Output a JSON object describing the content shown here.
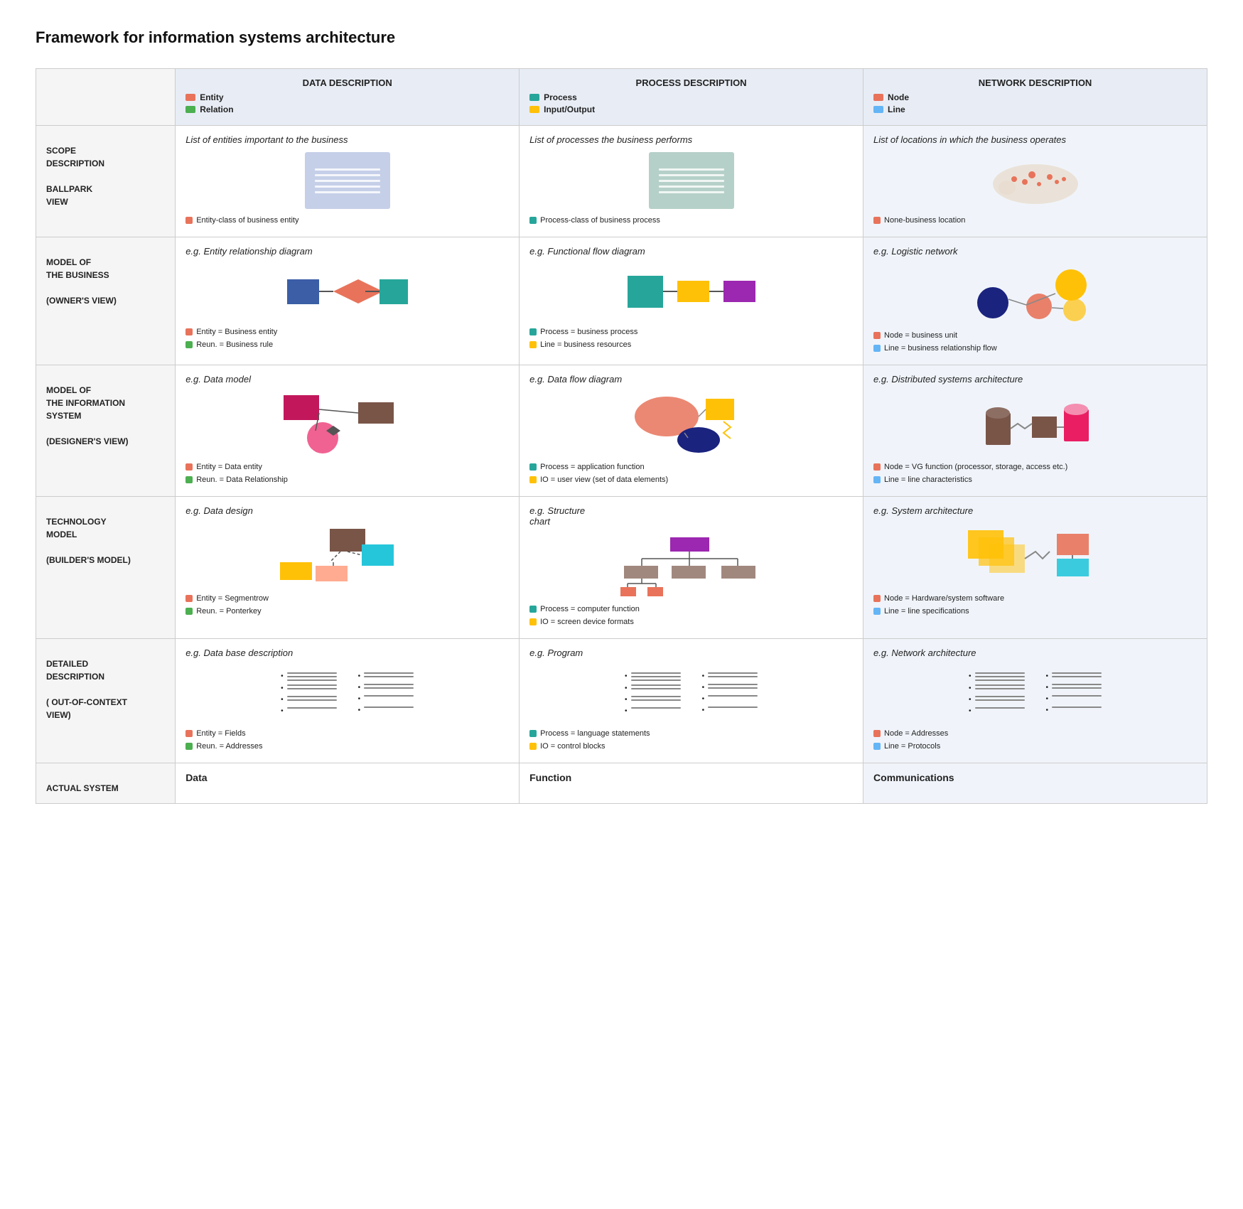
{
  "title": "Framework for information systems architecture",
  "header": {
    "col1": {
      "title": "DATA DESCRIPTION",
      "legend": [
        {
          "color": "#E8735A",
          "label": "Entity"
        },
        {
          "color": "#4CAF50",
          "label": "Relation"
        }
      ]
    },
    "col2": {
      "title": "PROCESS DESCRIPTION",
      "legend": [
        {
          "color": "#26A69A",
          "label": "Process"
        },
        {
          "color": "#FFC107",
          "label": "Input/Output"
        }
      ]
    },
    "col3": {
      "title": "NETWORK DESCRIPTION",
      "legend": [
        {
          "color": "#E8735A",
          "label": "Node"
        },
        {
          "color": "#64B5F6",
          "label": "Line"
        }
      ]
    }
  },
  "rows": [
    {
      "label": "SCOPE DESCRIPTION\n\nBALLPARK VIEW",
      "col1": {
        "title": "List of entities important to the business",
        "caption": [
          {
            "color": "#E8735A",
            "text": "Entity-class of business entity"
          }
        ]
      },
      "col2": {
        "title": "List of processes the business performs",
        "caption": [
          {
            "color": "#26A69A",
            "text": "Process-class of business process"
          }
        ]
      },
      "col3": {
        "title": "List of locations in which the business operates",
        "caption": [
          {
            "color": "#E8735A",
            "text": "None-business location"
          }
        ]
      }
    },
    {
      "label": "MODEL OF THE BUSINESS\n\n(OWNER'S VIEW)",
      "col1": {
        "title": "e.g. Entity relationship diagram",
        "caption": [
          {
            "color": "#E8735A",
            "text": "Entity = Business entity"
          },
          {
            "color": "#4CAF50",
            "text": "Reun. = Business rule"
          }
        ]
      },
      "col2": {
        "title": "e.g. Functional flow diagram",
        "caption": [
          {
            "color": "#26A69A",
            "text": "Process = business process"
          },
          {
            "color": "#FFC107",
            "text": "Line = business resources"
          }
        ]
      },
      "col3": {
        "title": "e.g. Logistic network",
        "caption": [
          {
            "color": "#E8735A",
            "text": "Node = business unit"
          },
          {
            "color": "#64B5F6",
            "text": "Line = business relationship flow"
          }
        ]
      }
    },
    {
      "label": "MODEL OF THE INFORMATION SYSTEM\n\n(DESIGNER'S VIEW)",
      "col1": {
        "title": "e.g. Data model",
        "caption": [
          {
            "color": "#E8735A",
            "text": "Entity = Data entity"
          },
          {
            "color": "#4CAF50",
            "text": "Reun. = Data Relationship"
          }
        ]
      },
      "col2": {
        "title": "e.g. Data flow diagram",
        "caption": [
          {
            "color": "#26A69A",
            "text": "Process = application function"
          },
          {
            "color": "#FFC107",
            "text": "IO = user view (set of data elements)"
          }
        ]
      },
      "col3": {
        "title": "e.g. Distributed systems architecture",
        "caption": [
          {
            "color": "#E8735A",
            "text": "Node = VG function (processor, storage, access etc.)"
          },
          {
            "color": "#64B5F6",
            "text": "Line = line characteristics"
          }
        ]
      }
    },
    {
      "label": "TECHNOLOGY MODEL\n\n(BUILDER'S MODEL)",
      "col1": {
        "title": "e.g. Data design",
        "caption": [
          {
            "color": "#E8735A",
            "text": "Entity = Segmentrow"
          },
          {
            "color": "#4CAF50",
            "text": "Reun. = Ponterkey"
          }
        ]
      },
      "col2": {
        "title": "e.g. Structure chart",
        "caption": [
          {
            "color": "#26A69A",
            "text": "Process = computer function"
          },
          {
            "color": "#FFC107",
            "text": "IO = screen device formats"
          }
        ]
      },
      "col3": {
        "title": "e.g. System architecture",
        "caption": [
          {
            "color": "#E8735A",
            "text": "Node = Hardware/system software"
          },
          {
            "color": "#64B5F6",
            "text": "Line = line specifications"
          }
        ]
      }
    },
    {
      "label": "DETAILED DESCRIPTION\n\n( OUT-OF-CONTEXT VIEW)",
      "col1": {
        "title": "e.g. Data base description",
        "caption": [
          {
            "color": "#E8735A",
            "text": "Entity = Fields"
          },
          {
            "color": "#4CAF50",
            "text": "Reun. = Addresses"
          }
        ]
      },
      "col2": {
        "title": "e.g. Program",
        "caption": [
          {
            "color": "#26A69A",
            "text": "Process = language statements"
          },
          {
            "color": "#FFC107",
            "text": "IO = control blocks"
          }
        ]
      },
      "col3": {
        "title": "e.g. Network architecture",
        "caption": [
          {
            "color": "#E8735A",
            "text": "Node = Addresses"
          },
          {
            "color": "#64B5F6",
            "text": "Line = Protocols"
          }
        ]
      }
    },
    {
      "label": "ACTUAL SYSTEM",
      "col1_actual": "Data",
      "col2_actual": "Function",
      "col3_actual": "Communications"
    }
  ]
}
